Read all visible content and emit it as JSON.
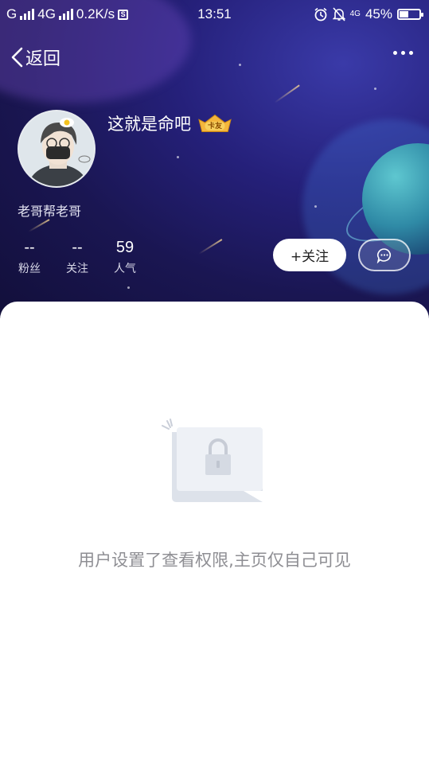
{
  "status_bar": {
    "carrier": "G",
    "network": "4G",
    "speed": "0.2K/s",
    "time": "13:51",
    "net_small": "4G",
    "battery": "45%",
    "battery_level": 0.45
  },
  "nav": {
    "back_label": "返回",
    "more_icon": "more-dots-icon"
  },
  "profile": {
    "display_name": "这就是命吧",
    "badge_text": "卡友",
    "subtitle": "老哥帮老哥",
    "stats": [
      {
        "value": "--",
        "label": "粉丝"
      },
      {
        "value": "--",
        "label": "关注"
      },
      {
        "value": "59",
        "label": "人气"
      }
    ],
    "follow_label": "+关注",
    "message_icon": "chat-bubble-icon"
  },
  "empty_state": {
    "icon": "lock-card-icon",
    "message": "用户设置了查看权限,主页仅自己可见"
  }
}
